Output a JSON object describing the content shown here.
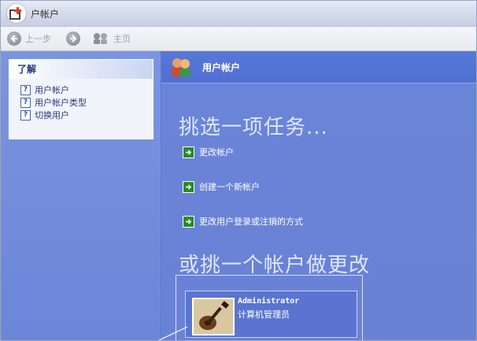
{
  "window": {
    "title": "户帐户"
  },
  "toolbar": {
    "back_label": "上一步",
    "home_label": "主页"
  },
  "left_panel": {
    "heading": "了解",
    "links": [
      {
        "label": "用户帐户",
        "icon": "help-icon"
      },
      {
        "label": "用户帐户类型",
        "icon": "help-icon"
      },
      {
        "label": "切换用户",
        "icon": "help-icon"
      }
    ]
  },
  "main": {
    "header_title": "用户帐户",
    "pick_task_heading": "挑选一项任务...",
    "tasks": [
      {
        "label": "更改帐户",
        "icon": "green-arrow-icon"
      },
      {
        "label": "创建一个新帐户",
        "icon": "green-arrow-icon"
      },
      {
        "label": "更改用户登录或注销的方式",
        "icon": "green-arrow-icon"
      }
    ],
    "pick_account_heading": "或挑一个帐户做更改",
    "accounts": [
      {
        "name": "Administrator",
        "role": "计算机管理员",
        "avatar": "guitar-picture"
      }
    ]
  },
  "colors": {
    "pane_blue": "#6c86d8",
    "header_blue": "#5878d8",
    "task_arrow_green": "#2a8a2a"
  }
}
